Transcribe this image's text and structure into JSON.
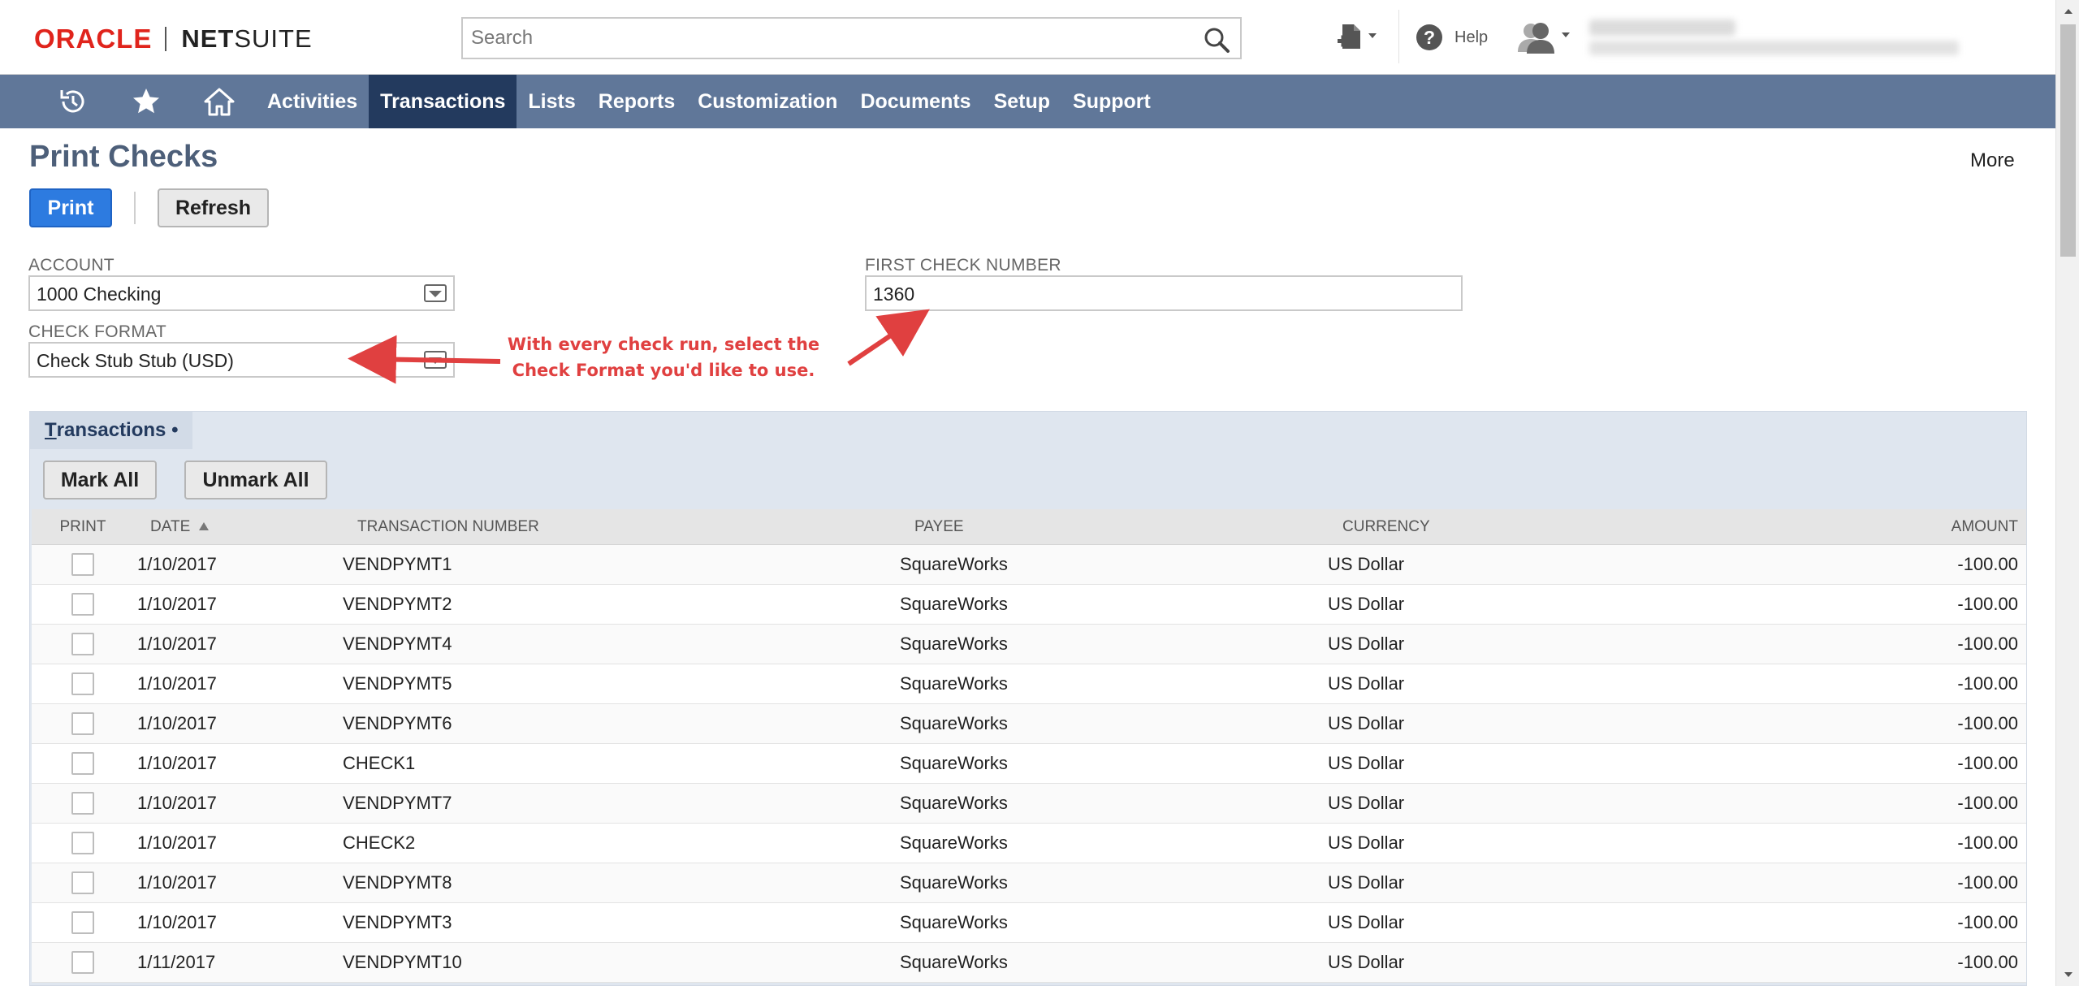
{
  "header": {
    "logo_oracle": "ORACLE",
    "logo_netsuite_bold": "NET",
    "logo_netsuite_rest": "SUITE",
    "search_placeholder": "Search",
    "help_label": "Help"
  },
  "nav": {
    "icons": [
      "recent-records-icon",
      "star-icon",
      "home-icon"
    ],
    "items": [
      "Activities",
      "Transactions",
      "Lists",
      "Reports",
      "Customization",
      "Documents",
      "Setup",
      "Support"
    ],
    "active": "Transactions"
  },
  "page": {
    "title": "Print Checks",
    "more_label": "More",
    "print_label": "Print",
    "refresh_label": "Refresh"
  },
  "form": {
    "account_label": "ACCOUNT",
    "account_value": "1000 Checking",
    "check_format_label": "CHECK FORMAT",
    "check_format_value": "Check Stub Stub (USD)",
    "first_check_label": "FIRST CHECK NUMBER",
    "first_check_value": "1360"
  },
  "annotation": {
    "line1": "With every check run, select the",
    "line2": "Check Format you'd like to use."
  },
  "transactions": {
    "tab_label_first": "T",
    "tab_label_rest": "ransactions",
    "tab_dot": "•",
    "mark_all_label": "Mark All",
    "unmark_all_label": "Unmark All",
    "columns": {
      "print": "PRINT",
      "date": "DATE",
      "transaction_number": "TRANSACTION NUMBER",
      "payee": "PAYEE",
      "currency": "CURRENCY",
      "amount": "AMOUNT"
    },
    "rows": [
      {
        "date": "1/10/2017",
        "number": "VENDPYMT1",
        "payee": "SquareWorks",
        "currency": "US Dollar",
        "amount": "-100.00"
      },
      {
        "date": "1/10/2017",
        "number": "VENDPYMT2",
        "payee": "SquareWorks",
        "currency": "US Dollar",
        "amount": "-100.00"
      },
      {
        "date": "1/10/2017",
        "number": "VENDPYMT4",
        "payee": "SquareWorks",
        "currency": "US Dollar",
        "amount": "-100.00"
      },
      {
        "date": "1/10/2017",
        "number": "VENDPYMT5",
        "payee": "SquareWorks",
        "currency": "US Dollar",
        "amount": "-100.00"
      },
      {
        "date": "1/10/2017",
        "number": "VENDPYMT6",
        "payee": "SquareWorks",
        "currency": "US Dollar",
        "amount": "-100.00"
      },
      {
        "date": "1/10/2017",
        "number": "CHECK1",
        "payee": "SquareWorks",
        "currency": "US Dollar",
        "amount": "-100.00"
      },
      {
        "date": "1/10/2017",
        "number": "VENDPYMT7",
        "payee": "SquareWorks",
        "currency": "US Dollar",
        "amount": "-100.00"
      },
      {
        "date": "1/10/2017",
        "number": "CHECK2",
        "payee": "SquareWorks",
        "currency": "US Dollar",
        "amount": "-100.00"
      },
      {
        "date": "1/10/2017",
        "number": "VENDPYMT8",
        "payee": "SquareWorks",
        "currency": "US Dollar",
        "amount": "-100.00"
      },
      {
        "date": "1/10/2017",
        "number": "VENDPYMT3",
        "payee": "SquareWorks",
        "currency": "US Dollar",
        "amount": "-100.00"
      },
      {
        "date": "1/11/2017",
        "number": "VENDPYMT10",
        "payee": "SquareWorks",
        "currency": "US Dollar",
        "amount": "-100.00"
      }
    ]
  },
  "colors": {
    "nav_bg": "#607799",
    "nav_active": "#233a5e",
    "primary_button": "#2d7be0",
    "annotation_red": "#e04040",
    "oracle_red": "#e0241c"
  }
}
